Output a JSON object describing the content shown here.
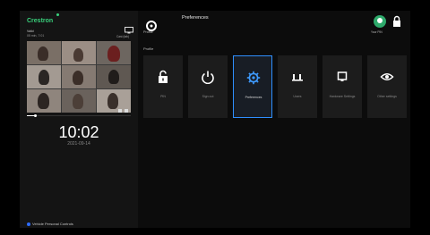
{
  "left": {
    "brand": "Crestron",
    "subtitle_1": "Valid",
    "subtitle_2": "05 min, 7:01",
    "cast_label": "Cast (tab)",
    "clock": "10:02",
    "date": "2021-09-14",
    "footer": "Vehicle Personal Controls",
    "video_progress_percent": 8
  },
  "right": {
    "nav_label": "Profile",
    "page_title": "Preferences",
    "user_label": "Your PIN",
    "section_label": "Profile",
    "tiles": [
      {
        "label": "PIN",
        "icon": "lock-icon"
      },
      {
        "label": "Sign out",
        "icon": "power-icon"
      },
      {
        "label": "Preferences",
        "icon": "gear-icon"
      },
      {
        "label": "Users",
        "icon": "people-icon"
      },
      {
        "label": "Hardware Settings",
        "icon": "hardware-icon"
      },
      {
        "label": "Other settings",
        "icon": "eye-icon"
      }
    ]
  },
  "colors": {
    "brand": "#39d17c",
    "active_border": "#2f8fff",
    "active_icon": "#3f9bff",
    "avatar": "#2ea96b"
  }
}
